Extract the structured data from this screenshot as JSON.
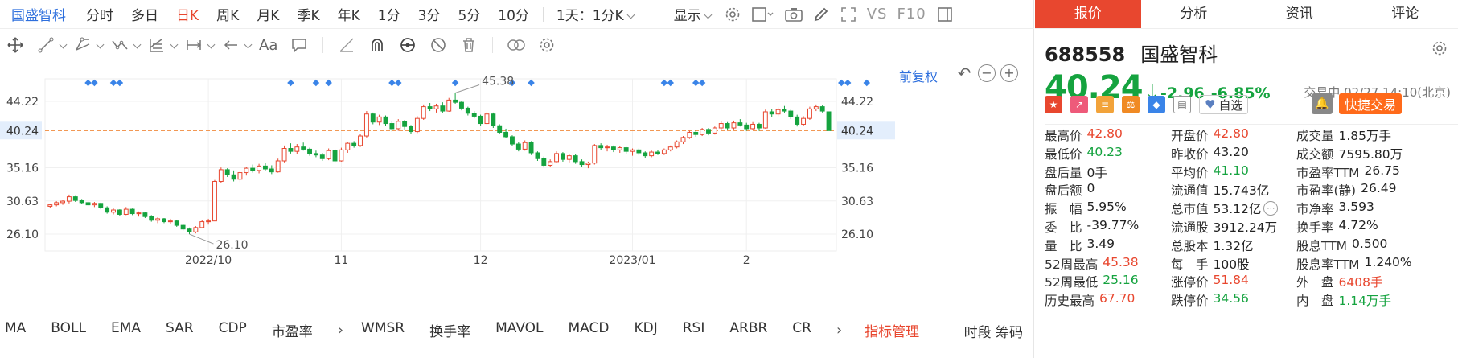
{
  "toolbar": {
    "stock_name": "国盛智科",
    "periods": [
      "分时",
      "多日",
      "日K",
      "周K",
      "月K",
      "季K",
      "年K",
      "1分",
      "3分",
      "5分",
      "10分"
    ],
    "active_period": "日K",
    "interval_select": "1天：1分K",
    "display_label": "显示",
    "vs_label": "VS",
    "f10_label": "F10"
  },
  "drawtools": {
    "text_tool": "Aa"
  },
  "chart": {
    "adjust_label": "前复权",
    "zoom_in": "+",
    "zoom_out": "−",
    "undo": "↶"
  },
  "indicators": {
    "items": [
      "MA",
      "BOLL",
      "EMA",
      "SAR",
      "CDP",
      "市盈率"
    ],
    "items2": [
      "WMSR",
      "换手率",
      "MAVOL",
      "MACD",
      "KDJ",
      "RSI",
      "ARBR",
      "CR"
    ],
    "manage": "指标管理",
    "right_links": "时段 筹码"
  },
  "panel": {
    "tabs": [
      "报价",
      "分析",
      "资讯",
      "评论"
    ],
    "active_tab": "报价",
    "code": "688558",
    "name": "国盛智科",
    "price": "40.24",
    "change": "-2.96",
    "change_pct": "-6.85%",
    "status": "交易中 02/27 14:10(北京)",
    "zixuan": "自选",
    "trade": "快捷交易",
    "quote_rows": [
      [
        {
          "l": "最高价",
          "v": "42.80",
          "c": "red"
        },
        {
          "l": "开盘价",
          "v": "42.80",
          "c": "red"
        },
        {
          "l": "成交量",
          "v": "1.85万手",
          "c": "blk"
        }
      ],
      [
        {
          "l": "最低价",
          "v": "40.23",
          "c": "green"
        },
        {
          "l": "昨收价",
          "v": "43.20",
          "c": "blk"
        },
        {
          "l": "成交额",
          "v": "7595.80万",
          "c": "blk"
        }
      ],
      [
        {
          "l": "盘后量",
          "v": "0手",
          "c": "blk"
        },
        {
          "l": "平均价",
          "v": "41.10",
          "c": "green"
        },
        {
          "l": "市盈率TTM",
          "v": "26.75",
          "c": "blk"
        }
      ],
      [
        {
          "l": "盘后额",
          "v": "0",
          "c": "blk"
        },
        {
          "l": "流通值",
          "v": "15.743亿",
          "c": "blk"
        },
        {
          "l": "市盈率(静)",
          "v": "26.49",
          "c": "blk"
        }
      ],
      [
        {
          "l": "振　幅",
          "v": "5.95%",
          "c": "blk"
        },
        {
          "l": "总市值",
          "v": "53.12亿",
          "c": "blk",
          "more": true
        },
        {
          "l": "市净率",
          "v": "3.593",
          "c": "blk"
        }
      ],
      [
        {
          "l": "委　比",
          "v": "-39.77%",
          "c": "blk"
        },
        {
          "l": "流通股",
          "v": "3912.24万",
          "c": "blk"
        },
        {
          "l": "换手率",
          "v": "4.72%",
          "c": "blk"
        }
      ],
      [
        {
          "l": "量　比",
          "v": "3.49",
          "c": "blk"
        },
        {
          "l": "总股本",
          "v": "1.32亿",
          "c": "blk"
        },
        {
          "l": "股息TTM",
          "v": "0.500",
          "c": "blk"
        }
      ],
      [
        {
          "l": "52周最高",
          "v": "45.38",
          "c": "red"
        },
        {
          "l": "每　手",
          "v": "100股",
          "c": "blk"
        },
        {
          "l": "股息率TTM",
          "v": "1.240%",
          "c": "blk"
        }
      ],
      [
        {
          "l": "52周最低",
          "v": "25.16",
          "c": "green"
        },
        {
          "l": "涨停价",
          "v": "51.84",
          "c": "red"
        },
        {
          "l": "外　盘",
          "v": "6408手",
          "c": "red"
        }
      ],
      [
        {
          "l": "历史最高",
          "v": "67.70",
          "c": "red"
        },
        {
          "l": "跌停价",
          "v": "34.56",
          "c": "green"
        },
        {
          "l": "内　盘",
          "v": "1.14万手",
          "c": "green"
        }
      ]
    ]
  },
  "chart_data": {
    "type": "candlestick",
    "yticks": [
      26.1,
      30.63,
      35.16,
      40.24,
      44.22
    ],
    "ylim": [
      23.8,
      47.3
    ],
    "current_price": "40.24",
    "max_label": "45.38",
    "min_label": "26.10",
    "xticks": [
      {
        "label": "2022/10",
        "i": 25
      },
      {
        "label": "11",
        "i": 46
      },
      {
        "label": "12",
        "i": 68
      },
      {
        "label": "2023/01",
        "i": 92
      },
      {
        "label": "2",
        "i": 110
      }
    ],
    "marker_days": [
      6,
      7,
      10,
      11,
      38,
      42,
      44,
      54,
      55,
      64,
      73,
      76,
      97,
      98,
      102,
      103,
      125,
      126,
      129
    ],
    "candles": [
      [
        29.9,
        30.2,
        29.7,
        30.1
      ],
      [
        30.1,
        30.6,
        29.9,
        30.4
      ],
      [
        30.4,
        30.8,
        30.1,
        30.6
      ],
      [
        30.6,
        31.5,
        30.3,
        31.2
      ],
      [
        31.2,
        31.3,
        30.5,
        30.7
      ],
      [
        30.7,
        30.9,
        30.2,
        30.4
      ],
      [
        30.4,
        30.6,
        29.9,
        30.1
      ],
      [
        30.1,
        30.5,
        29.8,
        30.3
      ],
      [
        30.3,
        30.4,
        29.5,
        29.7
      ],
      [
        29.7,
        29.9,
        28.9,
        29.1
      ],
      [
        29.1,
        29.6,
        28.8,
        29.4
      ],
      [
        29.4,
        29.5,
        28.6,
        28.8
      ],
      [
        28.8,
        29.8,
        28.7,
        29.5
      ],
      [
        29.5,
        29.6,
        28.7,
        28.9
      ],
      [
        28.9,
        29.2,
        28.5,
        29.0
      ],
      [
        29.0,
        29.1,
        28.3,
        28.5
      ],
      [
        28.5,
        28.7,
        27.8,
        28.0
      ],
      [
        28.0,
        28.4,
        27.6,
        28.2
      ],
      [
        28.2,
        28.3,
        27.6,
        27.8
      ],
      [
        27.8,
        28.2,
        27.5,
        27.9
      ],
      [
        27.9,
        28.0,
        27.1,
        27.3
      ],
      [
        27.3,
        27.5,
        26.6,
        26.8
      ],
      [
        26.8,
        27.0,
        26.1,
        26.4
      ],
      [
        26.4,
        27.2,
        26.2,
        27.0
      ],
      [
        27.0,
        28.0,
        26.9,
        27.8
      ],
      [
        27.8,
        28.2,
        27.4,
        27.9
      ],
      [
        27.9,
        33.5,
        27.9,
        33.3
      ],
      [
        33.3,
        35.2,
        33.1,
        34.9
      ],
      [
        34.9,
        35.1,
        33.9,
        34.2
      ],
      [
        34.2,
        34.8,
        33.3,
        33.6
      ],
      [
        33.6,
        34.7,
        33.2,
        34.5
      ],
      [
        34.5,
        35.3,
        34.1,
        35.1
      ],
      [
        35.1,
        35.6,
        34.5,
        34.8
      ],
      [
        34.8,
        35.7,
        34.4,
        35.4
      ],
      [
        35.4,
        35.8,
        34.8,
        35.0
      ],
      [
        35.0,
        35.5,
        34.3,
        34.6
      ],
      [
        34.6,
        36.4,
        34.5,
        36.1
      ],
      [
        36.1,
        38.2,
        35.9,
        37.8
      ],
      [
        37.8,
        38.5,
        37.1,
        37.4
      ],
      [
        37.4,
        38.4,
        37.0,
        38.0
      ],
      [
        38.0,
        38.6,
        37.5,
        37.7
      ],
      [
        37.7,
        37.9,
        36.8,
        37.1
      ],
      [
        37.1,
        37.5,
        36.6,
        36.9
      ],
      [
        36.9,
        37.2,
        36.1,
        36.4
      ],
      [
        36.4,
        37.8,
        36.2,
        37.5
      ],
      [
        37.5,
        37.7,
        35.8,
        36.1
      ],
      [
        36.1,
        37.9,
        36.0,
        37.6
      ],
      [
        37.6,
        38.7,
        37.2,
        38.5
      ],
      [
        38.5,
        38.8,
        37.9,
        38.2
      ],
      [
        38.2,
        39.8,
        38.0,
        39.5
      ],
      [
        39.5,
        42.9,
        39.3,
        42.5
      ],
      [
        42.5,
        42.7,
        41.1,
        41.4
      ],
      [
        41.4,
        42.4,
        41.0,
        42.1
      ],
      [
        42.1,
        42.3,
        40.9,
        41.2
      ],
      [
        41.2,
        41.5,
        40.1,
        40.5
      ],
      [
        40.5,
        41.8,
        40.2,
        41.5
      ],
      [
        41.5,
        41.7,
        40.4,
        40.8
      ],
      [
        40.8,
        41.0,
        39.8,
        40.1
      ],
      [
        40.1,
        42.2,
        39.9,
        41.9
      ],
      [
        41.9,
        43.8,
        41.7,
        43.5
      ],
      [
        43.5,
        44.0,
        42.9,
        43.2
      ],
      [
        43.2,
        43.9,
        42.7,
        43.6
      ],
      [
        43.6,
        44.1,
        42.6,
        42.9
      ],
      [
        42.9,
        44.7,
        42.8,
        44.4
      ],
      [
        44.4,
        45.38,
        43.9,
        44.1
      ],
      [
        44.1,
        44.3,
        43.0,
        43.3
      ],
      [
        43.3,
        43.5,
        42.3,
        42.6
      ],
      [
        42.6,
        42.9,
        41.9,
        42.2
      ],
      [
        42.2,
        42.4,
        40.9,
        41.2
      ],
      [
        41.2,
        42.8,
        41.0,
        42.5
      ],
      [
        42.5,
        42.7,
        40.6,
        40.9
      ],
      [
        40.9,
        41.1,
        39.8,
        40.0
      ],
      [
        40.0,
        40.5,
        39.2,
        39.4
      ],
      [
        39.4,
        39.6,
        38.1,
        38.4
      ],
      [
        38.4,
        38.7,
        37.4,
        37.7
      ],
      [
        37.7,
        38.9,
        37.5,
        38.6
      ],
      [
        38.6,
        38.8,
        36.9,
        37.2
      ],
      [
        37.2,
        37.4,
        36.1,
        36.4
      ],
      [
        36.4,
        36.7,
        35.2,
        35.5
      ],
      [
        35.5,
        36.3,
        35.3,
        36.0
      ],
      [
        36.0,
        37.4,
        35.9,
        37.1
      ],
      [
        37.1,
        37.3,
        36.0,
        36.3
      ],
      [
        36.3,
        37.0,
        35.9,
        36.8
      ],
      [
        36.8,
        37.0,
        35.7,
        36.0
      ],
      [
        36.0,
        36.3,
        35.3,
        35.6
      ],
      [
        35.6,
        36.0,
        35.1,
        35.8
      ],
      [
        35.8,
        38.4,
        35.6,
        38.2
      ],
      [
        38.2,
        38.5,
        37.6,
        37.9
      ],
      [
        37.9,
        38.3,
        37.4,
        38.0
      ],
      [
        38.0,
        38.2,
        37.3,
        37.6
      ],
      [
        37.6,
        38.1,
        37.2,
        37.9
      ],
      [
        37.9,
        38.0,
        37.1,
        37.4
      ],
      [
        37.4,
        37.8,
        36.8,
        37.6
      ],
      [
        37.6,
        37.8,
        36.9,
        37.2
      ],
      [
        37.2,
        37.4,
        36.5,
        36.8
      ],
      [
        36.8,
        37.5,
        36.6,
        37.3
      ],
      [
        37.3,
        37.6,
        36.9,
        37.1
      ],
      [
        37.1,
        37.8,
        36.9,
        37.6
      ],
      [
        37.6,
        38.2,
        37.4,
        38.0
      ],
      [
        38.0,
        38.9,
        37.8,
        38.7
      ],
      [
        38.7,
        39.5,
        38.4,
        39.3
      ],
      [
        39.3,
        40.2,
        39.1,
        40.0
      ],
      [
        40.0,
        40.3,
        39.4,
        39.7
      ],
      [
        39.7,
        40.6,
        39.5,
        40.4
      ],
      [
        40.4,
        40.6,
        39.6,
        39.9
      ],
      [
        39.9,
        40.8,
        39.7,
        40.6
      ],
      [
        40.6,
        41.5,
        40.3,
        41.2
      ],
      [
        41.2,
        41.4,
        40.3,
        40.6
      ],
      [
        40.6,
        41.6,
        40.4,
        41.3
      ],
      [
        41.3,
        41.8,
        40.8,
        41.0
      ],
      [
        41.0,
        41.3,
        40.2,
        40.5
      ],
      [
        40.5,
        41.4,
        40.3,
        41.1
      ],
      [
        41.1,
        41.3,
        40.2,
        40.6
      ],
      [
        40.6,
        43.1,
        40.5,
        42.8
      ],
      [
        42.8,
        43.2,
        42.1,
        42.5
      ],
      [
        42.5,
        43.4,
        42.2,
        43.1
      ],
      [
        43.1,
        43.6,
        42.6,
        42.9
      ],
      [
        42.9,
        43.1,
        41.8,
        42.1
      ],
      [
        42.1,
        42.4,
        40.8,
        41.1
      ],
      [
        41.1,
        42.2,
        40.9,
        41.9
      ],
      [
        41.9,
        43.5,
        41.7,
        43.2
      ],
      [
        43.2,
        43.8,
        42.9,
        43.5
      ],
      [
        43.5,
        43.7,
        42.7,
        42.9
      ],
      [
        42.8,
        42.8,
        40.23,
        40.24
      ]
    ]
  }
}
